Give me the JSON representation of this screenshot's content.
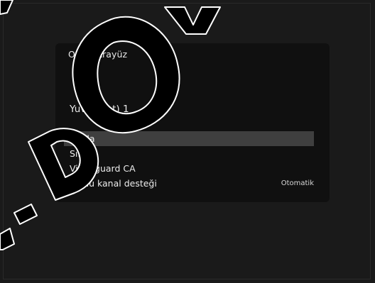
{
  "panel": {
    "title": "Ortak Arayüz",
    "slot_title": "Yuva (slot) 1"
  },
  "menu": {
    "items": [
      {
        "label": "Sıfırla",
        "value": "",
        "selected": true
      },
      {
        "label": "Sıfırla",
        "value": "",
        "selected": false
      },
      {
        "label": "Videoguard CA",
        "value": "",
        "selected": false
      },
      {
        "label": "Çoklu kanal desteği",
        "value": "Otomatik",
        "selected": false
      }
    ]
  },
  "colors": {
    "background": "#1a1a1a",
    "panel": "#101010",
    "selection": "#3f3f3f",
    "text": "#e6e6e6",
    "watermark_outline": "#ffffff",
    "watermark_fill": "#000000"
  }
}
